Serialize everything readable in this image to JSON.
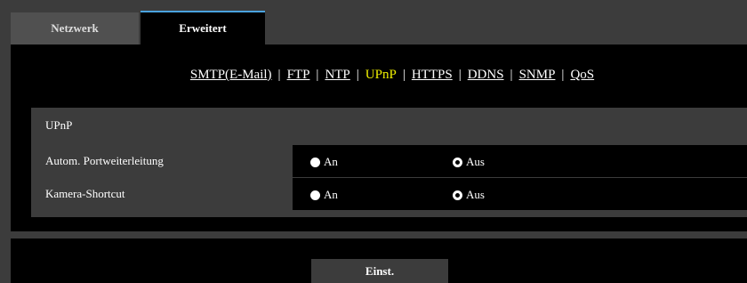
{
  "tabs": [
    {
      "label": "Netzwerk",
      "active": false
    },
    {
      "label": "Erweitert",
      "active": true
    }
  ],
  "subnav": {
    "items": [
      "SMTP(E-Mail)",
      "FTP",
      "NTP",
      "UPnP",
      "HTTPS",
      "DDNS",
      "SNMP",
      "QoS"
    ],
    "active": "UPnP",
    "separator": "|"
  },
  "section": {
    "title": "UPnP"
  },
  "settings": [
    {
      "label": "Autom. Portweiterleitung",
      "option_on": "An",
      "option_off": "Aus",
      "selected": "Aus"
    },
    {
      "label": "Kamera-Shortcut",
      "option_on": "An",
      "option_off": "Aus",
      "selected": "Aus"
    }
  ],
  "footer": {
    "button_label": "Einst."
  },
  "colors": {
    "active_link": "#f0f000",
    "tab_accent": "#4aa3df",
    "background": "#3c3c3c",
    "panel": "#000000"
  }
}
